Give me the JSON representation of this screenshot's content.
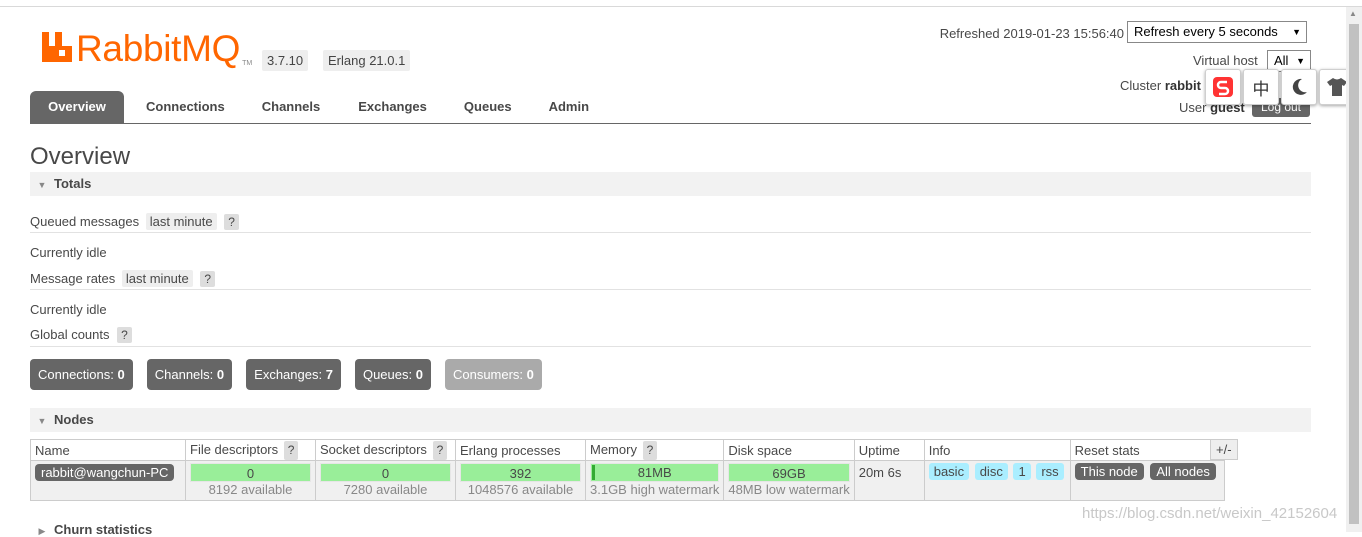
{
  "header": {
    "logo_text": "RabbitMQ",
    "logo_tm": "TM",
    "version": "3.7.10",
    "erlang": "Erlang 21.0.1",
    "refreshed": "Refreshed 2019-01-23 15:56:40",
    "refresh_option": "Refresh every 5 seconds",
    "virtual_host_label": "Virtual host",
    "virtual_host_value": "All",
    "cluster_label": "Cluster",
    "cluster_value": "rabbit",
    "user_label": "User",
    "user_value": "guest",
    "logout_label": "Log out"
  },
  "extensions": [
    {
      "icon": "sogou-s-icon",
      "glyph": "S"
    },
    {
      "icon": "chinese-input-icon",
      "glyph": "中"
    },
    {
      "icon": "moon-icon",
      "glyph": "☽"
    },
    {
      "icon": "tshirt-icon",
      "glyph": "👕"
    }
  ],
  "tabs": [
    "Overview",
    "Connections",
    "Channels",
    "Exchanges",
    "Queues",
    "Admin"
  ],
  "active_tab": "Overview",
  "page_title": "Overview",
  "totals": {
    "title": "Totals",
    "queued_messages_label": "Queued messages",
    "queued_messages_period": "last minute",
    "help": "?",
    "queued_idle": "Currently idle",
    "message_rates_label": "Message rates",
    "message_rates_period": "last minute",
    "rates_idle": "Currently idle",
    "global_counts_label": "Global counts",
    "counts": [
      {
        "label": "Connections:",
        "value": "0"
      },
      {
        "label": "Channels:",
        "value": "0"
      },
      {
        "label": "Exchanges:",
        "value": "7"
      },
      {
        "label": "Queues:",
        "value": "0"
      },
      {
        "label": "Consumers:",
        "value": "0"
      }
    ]
  },
  "nodes": {
    "title": "Nodes",
    "columns": [
      "Name",
      "File descriptors",
      "Socket descriptors",
      "Erlang processes",
      "Memory",
      "Disk space",
      "Uptime",
      "Info",
      "Reset stats"
    ],
    "plus_minus": "+/-",
    "row": {
      "name": "rabbit@wangchun-PC",
      "file_descriptors": "0",
      "file_descriptors_avail": "8192 available",
      "socket_descriptors": "0",
      "socket_descriptors_avail": "7280 available",
      "erlang_processes": "392",
      "erlang_processes_avail": "1048576 available",
      "memory": "81MB",
      "memory_watermark": "3.1GB high watermark",
      "disk_space": "69GB",
      "disk_watermark": "48MB low watermark",
      "uptime": "20m 6s",
      "info": [
        "basic",
        "disc",
        "1",
        "rss"
      ],
      "reset": [
        "This node",
        "All nodes"
      ]
    }
  },
  "churn_title": "Churn statistics",
  "watermark": "https://blog.csdn.net/weixin_42152604"
}
